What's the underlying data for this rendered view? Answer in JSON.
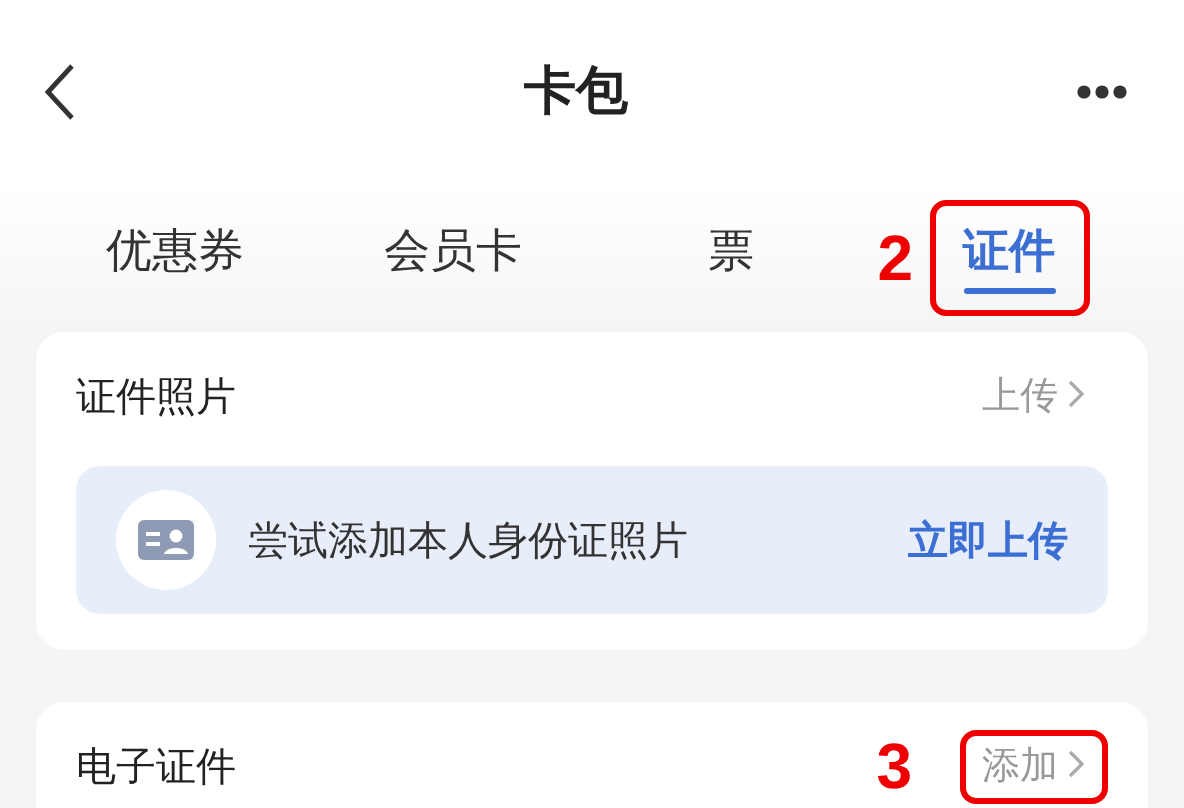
{
  "header": {
    "title": "卡包"
  },
  "tabs": [
    {
      "label": "优惠券",
      "selected": false
    },
    {
      "label": "会员卡",
      "selected": false
    },
    {
      "label": "票",
      "selected": false
    },
    {
      "label": "证件",
      "selected": true,
      "callout": "2"
    }
  ],
  "sections": [
    {
      "title": "证件照片",
      "action": "上传",
      "banner": {
        "text": "尝试添加本人身份证照片",
        "action": "立即上传"
      }
    },
    {
      "title": "电子证件",
      "action": "添加",
      "callout": "3"
    }
  ]
}
